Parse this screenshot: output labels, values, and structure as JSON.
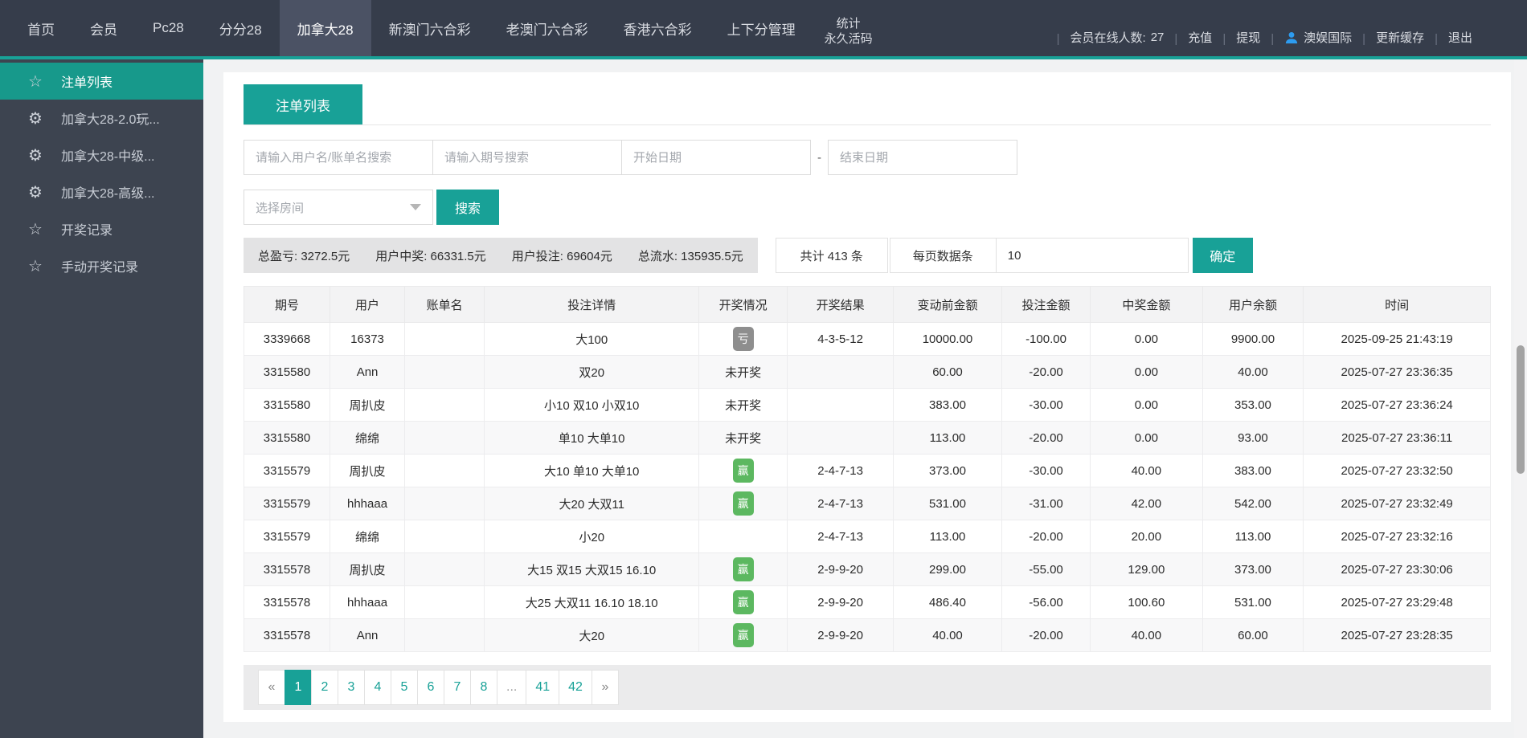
{
  "colors": {
    "accent_teal": "#18a197",
    "sidebar_active_teal": "#17998b",
    "navbar_bg": "#363d4b",
    "sidebar_bg": "#3d4450",
    "win_badge_green": "#5cb860",
    "lose_badge_gray": "#8e8e8e",
    "user_icon_blue": "#2d9cf0"
  },
  "navbar": {
    "items": [
      {
        "label": "首页",
        "active": false
      },
      {
        "label": "会员",
        "active": false
      },
      {
        "label": "Pc28",
        "active": false
      },
      {
        "label": "分分28",
        "active": false
      },
      {
        "label": "加拿大28",
        "active": true
      },
      {
        "label": "新澳门六合彩",
        "active": false
      },
      {
        "label": "老澳门六合彩",
        "active": false
      },
      {
        "label": "香港六合彩",
        "active": false
      },
      {
        "label": "上下分管理",
        "active": false
      }
    ],
    "stacked": [
      "统计",
      "永久活码"
    ],
    "right": {
      "online_label": "会员在线人数:",
      "online_count": "27",
      "recharge": "充值",
      "withdraw": "提现",
      "account": "澳娱国际",
      "refresh_cache": "更新缓存",
      "logout": "退出",
      "separator": "|"
    }
  },
  "sidebar": {
    "items": [
      {
        "label": "注单列表",
        "icon": "star",
        "active": true
      },
      {
        "label": "加拿大28-2.0玩...",
        "icon": "gear",
        "active": false
      },
      {
        "label": "加拿大28-中级...",
        "icon": "gear",
        "active": false
      },
      {
        "label": "加拿大28-高级...",
        "icon": "gear",
        "active": false
      },
      {
        "label": "开奖记录",
        "icon": "star",
        "active": false
      },
      {
        "label": "手动开奖记录",
        "icon": "star",
        "active": false
      }
    ]
  },
  "main": {
    "tab_label": "注单列表",
    "search": {
      "user_placeholder": "请输入用户名/账单名搜索",
      "issue_placeholder": "请输入期号搜索",
      "start_date_placeholder": "开始日期",
      "date_separator": "-",
      "end_date_placeholder": "结束日期",
      "room_placeholder": "选择房间",
      "search_button": "搜索"
    },
    "stats": [
      {
        "label": "总盈亏:",
        "value": "3272.5元"
      },
      {
        "label": "用户中奖:",
        "value": "66331.5元"
      },
      {
        "label": "用户投注:",
        "value": "69604元"
      },
      {
        "label": "总流水:",
        "value": "135935.5元"
      }
    ],
    "pager": {
      "total_text": "共计 413 条",
      "per_page_label": "每页数据条",
      "per_page_value": "10",
      "confirm_label": "确定"
    },
    "table": {
      "columns": [
        "期号",
        "用户",
        "账单名",
        "投注详情",
        "开奖情况",
        "开奖结果",
        "变动前金额",
        "投注金额",
        "中奖金额",
        "用户余额",
        "时间"
      ],
      "rows": [
        {
          "issue": "3339668",
          "user": "16373",
          "bill": "",
          "detail": "大100",
          "status": {
            "type": "lose",
            "text": "亏"
          },
          "result": "4-3-5-12",
          "before": "10000.00",
          "bet": "-100.00",
          "win": "0.00",
          "balance": "9900.00",
          "time": "2025-09-25 21:43:19"
        },
        {
          "issue": "3315580",
          "user": "Ann",
          "bill": "",
          "detail": "双20",
          "status": {
            "type": "text",
            "text": "未开奖"
          },
          "result": "",
          "before": "60.00",
          "bet": "-20.00",
          "win": "0.00",
          "balance": "40.00",
          "time": "2025-07-27 23:36:35"
        },
        {
          "issue": "3315580",
          "user": "周扒皮",
          "bill": "",
          "detail": "小10 双10 小双10",
          "status": {
            "type": "text",
            "text": "未开奖"
          },
          "result": "",
          "before": "383.00",
          "bet": "-30.00",
          "win": "0.00",
          "balance": "353.00",
          "time": "2025-07-27 23:36:24"
        },
        {
          "issue": "3315580",
          "user": "绵绵",
          "bill": "",
          "detail": "单10 大单10",
          "status": {
            "type": "text",
            "text": "未开奖"
          },
          "result": "",
          "before": "113.00",
          "bet": "-20.00",
          "win": "0.00",
          "balance": "93.00",
          "time": "2025-07-27 23:36:11"
        },
        {
          "issue": "3315579",
          "user": "周扒皮",
          "bill": "",
          "detail": "大10 单10 大单10",
          "status": {
            "type": "win",
            "text": "赢"
          },
          "result": "2-4-7-13",
          "before": "373.00",
          "bet": "-30.00",
          "win": "40.00",
          "balance": "383.00",
          "time": "2025-07-27 23:32:50"
        },
        {
          "issue": "3315579",
          "user": "hhhaaa",
          "bill": "",
          "detail": "大20 大双11",
          "status": {
            "type": "win",
            "text": "赢"
          },
          "result": "2-4-7-13",
          "before": "531.00",
          "bet": "-31.00",
          "win": "42.00",
          "balance": "542.00",
          "time": "2025-07-27 23:32:49"
        },
        {
          "issue": "3315579",
          "user": "绵绵",
          "bill": "",
          "detail": "小20",
          "status": {
            "type": "none",
            "text": ""
          },
          "result": "2-4-7-13",
          "before": "113.00",
          "bet": "-20.00",
          "win": "20.00",
          "balance": "113.00",
          "time": "2025-07-27 23:32:16"
        },
        {
          "issue": "3315578",
          "user": "周扒皮",
          "bill": "",
          "detail": "大15 双15 大双15 16.10",
          "status": {
            "type": "win",
            "text": "赢"
          },
          "result": "2-9-9-20",
          "before": "299.00",
          "bet": "-55.00",
          "win": "129.00",
          "balance": "373.00",
          "time": "2025-07-27 23:30:06"
        },
        {
          "issue": "3315578",
          "user": "hhhaaa",
          "bill": "",
          "detail": "大25 大双11 16.10 18.10",
          "status": {
            "type": "win",
            "text": "赢"
          },
          "result": "2-9-9-20",
          "before": "486.40",
          "bet": "-56.00",
          "win": "100.60",
          "balance": "531.00",
          "time": "2025-07-27 23:29:48"
        },
        {
          "issue": "3315578",
          "user": "Ann",
          "bill": "",
          "detail": "大20",
          "status": {
            "type": "win",
            "text": "赢"
          },
          "result": "2-9-9-20",
          "before": "40.00",
          "bet": "-20.00",
          "win": "40.00",
          "balance": "60.00",
          "time": "2025-07-27 23:28:35"
        }
      ]
    },
    "pagination": {
      "items": [
        {
          "text": "«",
          "type": "prev"
        },
        {
          "text": "1",
          "type": "page",
          "active": true
        },
        {
          "text": "2",
          "type": "page"
        },
        {
          "text": "3",
          "type": "page"
        },
        {
          "text": "4",
          "type": "page"
        },
        {
          "text": "5",
          "type": "page"
        },
        {
          "text": "6",
          "type": "page"
        },
        {
          "text": "7",
          "type": "page"
        },
        {
          "text": "8",
          "type": "page"
        },
        {
          "text": "...",
          "type": "ellipsis"
        },
        {
          "text": "41",
          "type": "page"
        },
        {
          "text": "42",
          "type": "page"
        },
        {
          "text": "»",
          "type": "next"
        }
      ]
    }
  }
}
